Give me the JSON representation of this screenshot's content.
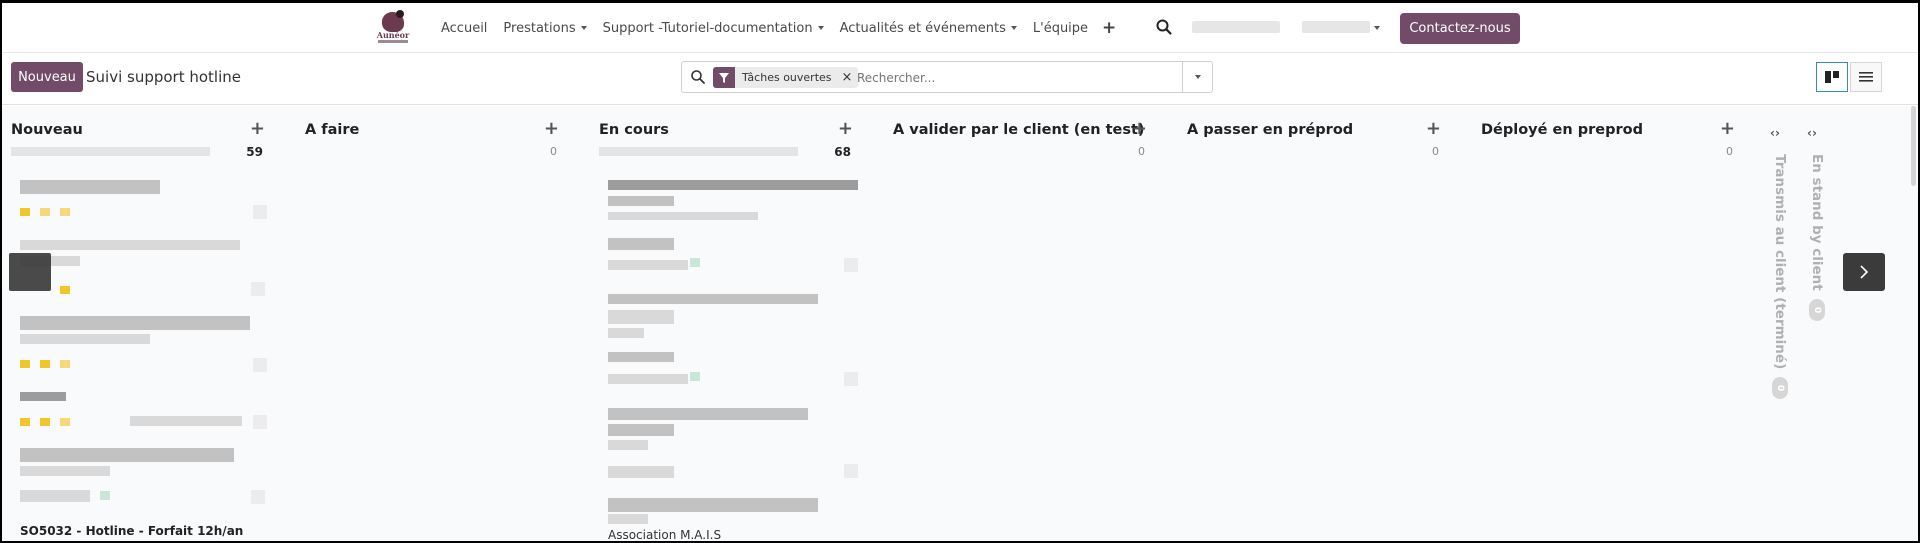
{
  "navbar": {
    "logo_text": "Aunéor",
    "menu": [
      {
        "label": "Accueil",
        "dropdown": false
      },
      {
        "label": "Prestations",
        "dropdown": true
      },
      {
        "label": "Support -Tutoriel-documentation",
        "dropdown": true
      },
      {
        "label": "Actualités et événements",
        "dropdown": true
      },
      {
        "label": "L'équipe",
        "dropdown": false
      }
    ],
    "add_icon": "plus-icon",
    "search_icon": "search-icon",
    "contact_label": "Contactez-nous"
  },
  "control": {
    "new_label": "Nouveau",
    "title": "Suivi support hotline",
    "search": {
      "facet_icon": "filter-icon",
      "facet_label": "Tâches ouvertes",
      "facet_remove": "×",
      "placeholder": "Rechercher..."
    },
    "views": [
      "kanban-view",
      "list-view"
    ]
  },
  "kanban": {
    "columns": [
      {
        "title": "Nouveau",
        "count": "59"
      },
      {
        "title": "A faire",
        "count": "0"
      },
      {
        "title": "En cours",
        "count": "68"
      },
      {
        "title": "A valider par le client (en test)",
        "count": "0"
      },
      {
        "title": "A passer en préprod",
        "count": "0"
      },
      {
        "title": "Déployé en preprod",
        "count": "0"
      }
    ],
    "folded": [
      {
        "title": "Transmis au client (terminé)",
        "count": "0"
      },
      {
        "title": "En stand by client",
        "count": "0"
      }
    ],
    "visible_cards": {
      "nouveau_last": "SO5032 - Hotline - Forfait 12h/an",
      "en_cours_last": "Association M.A.I.S"
    }
  },
  "colors": {
    "brand": "#714b67",
    "active_view": "#3a8cab",
    "priority_star": "#f0c62a"
  }
}
